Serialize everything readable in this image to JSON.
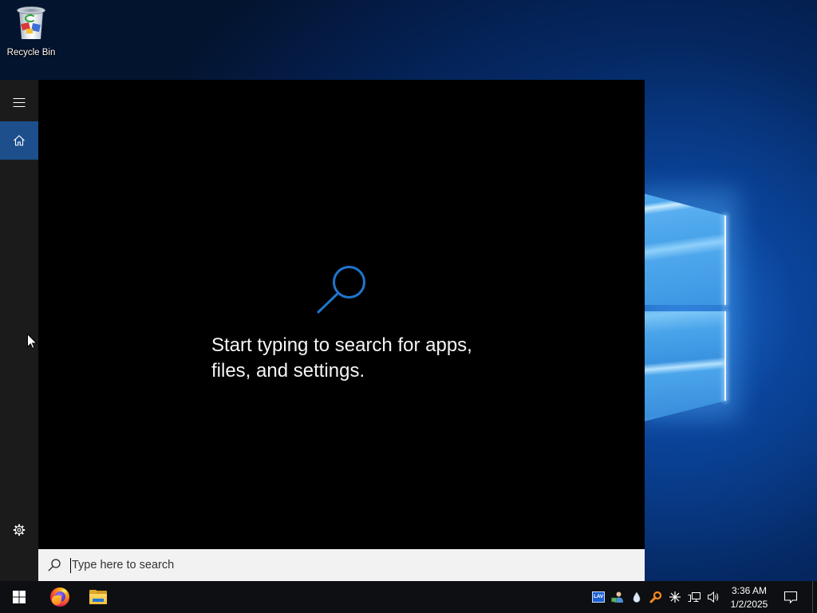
{
  "desktop": {
    "wallpaper": {
      "icon": "windows-logo-icon"
    },
    "icons": [
      {
        "icon": "recycle-bin-icon",
        "label": "Recycle Bin"
      }
    ]
  },
  "search_panel": {
    "rail": {
      "menu": {
        "icon": "hamburger-icon"
      },
      "home": {
        "icon": "home-icon",
        "selected": true
      },
      "settings": {
        "icon": "gear-icon"
      }
    },
    "empty_state": {
      "icon": "search-icon",
      "lines": [
        "Start typing to search for apps,",
        "files, and settings."
      ]
    },
    "search_box": {
      "icon": "search-icon",
      "placeholder": "Type here to search",
      "value": ""
    }
  },
  "taskbar": {
    "start_button": {
      "icon": "windows-logo-icon"
    },
    "pinned_apps": [
      {
        "icon": "firefox-icon"
      },
      {
        "icon": "file-explorer-icon"
      }
    ],
    "tray_icons": [
      {
        "icon": "lav-filters-icon",
        "label": "LAV"
      },
      {
        "icon": "user-network-icon"
      },
      {
        "icon": "water-drop-icon"
      },
      {
        "icon": "orange-search-icon"
      },
      {
        "icon": "asterisk-icon"
      },
      {
        "icon": "network-icon"
      },
      {
        "icon": "volume-icon"
      }
    ],
    "clock": {
      "time": "3:36 AM",
      "date": "1/2/2025"
    },
    "action_center": {
      "icon": "notification-icon"
    }
  },
  "pointer": {
    "icon": "arrow-cursor-icon"
  },
  "colors": {
    "accent": "#1c4f8c",
    "search_glyph": "#1f76cf",
    "rail_bg": "#1b1b1b",
    "panel_bg": "#000000",
    "search_box_bg": "#f2f2f2",
    "taskbar_bg": "#0e0f12",
    "text_light": "#ffffff"
  }
}
